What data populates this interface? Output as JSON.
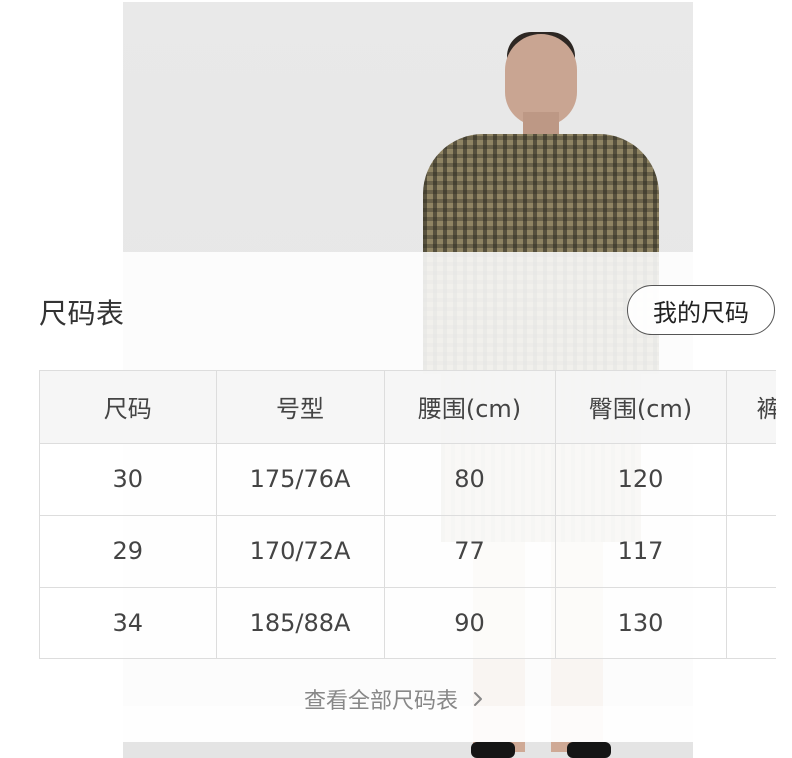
{
  "size_chart": {
    "title": "尺码表",
    "my_size_button": "我的尺码",
    "columns": [
      "尺码",
      "号型",
      "腰围(cm)",
      "臀围(cm)",
      "裤"
    ],
    "rows": [
      [
        "30",
        "175/76A",
        "80",
        "120",
        ""
      ],
      [
        "29",
        "170/72A",
        "77",
        "117",
        ""
      ],
      [
        "34",
        "185/88A",
        "90",
        "130",
        ""
      ]
    ],
    "view_all_link": "查看全部尺码表"
  },
  "icons": {
    "view_all_icon": "chevron-right-icon"
  }
}
